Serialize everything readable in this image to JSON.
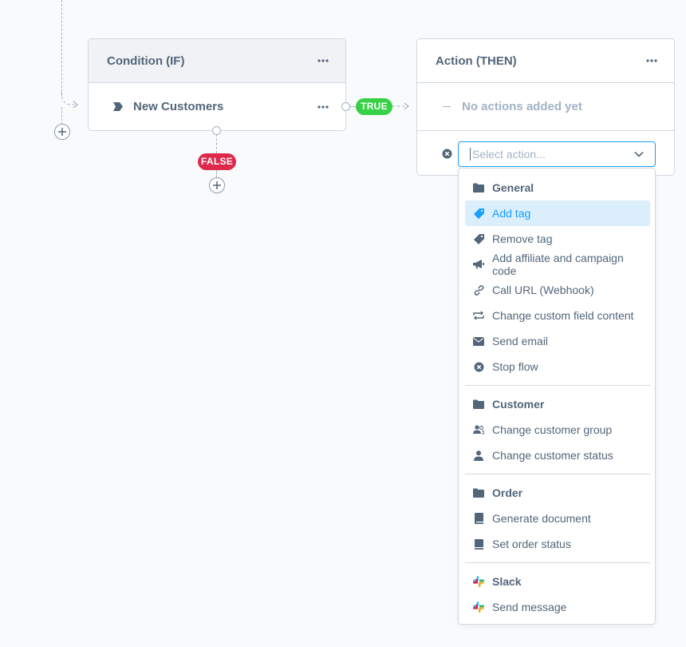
{
  "condition": {
    "title": "Condition (IF)",
    "rule_label": "New Customers"
  },
  "branches": {
    "true_label": "TRUE",
    "false_label": "FALSE",
    "true_color": "#37d046",
    "false_color": "#de294c"
  },
  "action": {
    "title": "Action (THEN)",
    "empty_text": "No actions added yet",
    "select_placeholder": "Select action..."
  },
  "menu": {
    "groups": [
      {
        "label": "General",
        "items": [
          {
            "label": "Add tag",
            "icon": "tag-icon",
            "active": true
          },
          {
            "label": "Remove tag",
            "icon": "tag-icon"
          },
          {
            "label": "Add affiliate and campaign code",
            "icon": "megaphone-icon"
          },
          {
            "label": "Call URL (Webhook)",
            "icon": "link-icon"
          },
          {
            "label": "Change custom field content",
            "icon": "swap-icon"
          },
          {
            "label": "Send email",
            "icon": "envelope-icon"
          },
          {
            "label": "Stop flow",
            "icon": "x-circle-icon"
          }
        ]
      },
      {
        "label": "Customer",
        "items": [
          {
            "label": "Change customer group",
            "icon": "users-icon"
          },
          {
            "label": "Change customer status",
            "icon": "user-icon"
          }
        ]
      },
      {
        "label": "Order",
        "items": [
          {
            "label": "Generate document",
            "icon": "document-icon"
          },
          {
            "label": "Set order status",
            "icon": "status-icon"
          }
        ]
      },
      {
        "label": "Slack",
        "items": [
          {
            "label": "Send message",
            "icon": "slack-icon"
          }
        ]
      }
    ]
  },
  "colors": {
    "accent": "#189eff",
    "active_bg": "#dbeefc",
    "text": "#52667a",
    "muted": "#a3b3c5",
    "border": "#d1d9e0"
  }
}
